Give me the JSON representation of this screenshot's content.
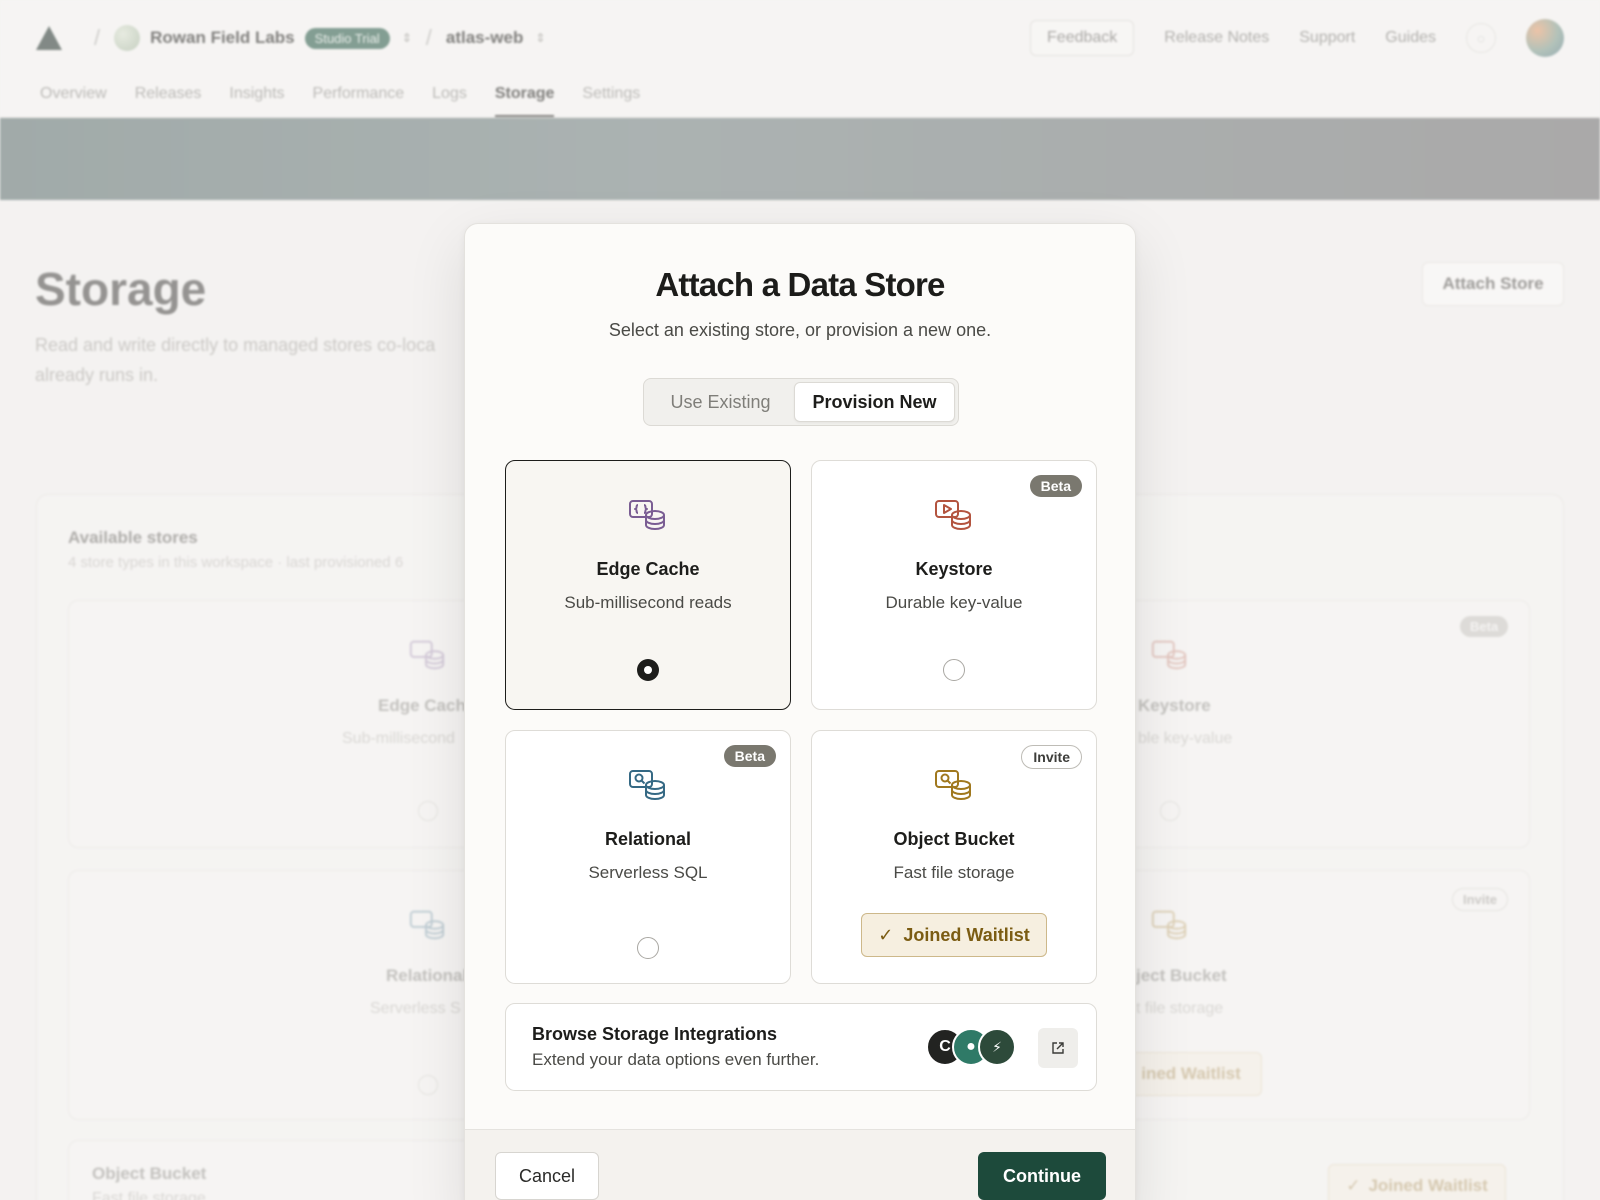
{
  "header": {
    "org_name": "Rowan Field Labs",
    "plan_badge": "Studio Trial",
    "project_name": "atlas-web",
    "feedback_label": "Feedback",
    "links": [
      "Release Notes",
      "Support",
      "Guides"
    ]
  },
  "nav": {
    "tabs": [
      "Overview",
      "Releases",
      "Insights",
      "Performance",
      "Logs",
      "Storage",
      "Settings"
    ],
    "active_tab": "Storage"
  },
  "page": {
    "title": "Storage",
    "description": "Read and write directly to managed stores co-loca already runs in.",
    "attach_store_label": "Attach Store",
    "panel_title": "Available stores",
    "panel_subtitle": "4 store types in this workspace · last provisioned 6",
    "cards": [
      {
        "title": "Edge Cache",
        "desc": "Sub-millisecond"
      },
      {
        "title": "Keystore",
        "desc": "ble key-value",
        "badge": "Beta"
      },
      {
        "title": "Relational",
        "desc": "Serverless S"
      },
      {
        "title": "ject Bucket",
        "desc": "t file storage",
        "badge": "Invite",
        "action": "ined Waitlist"
      },
      {
        "title": "Object Bucket",
        "desc": "Fast file storage"
      }
    ],
    "bottom_waitlist_label": "Joined Waitlist"
  },
  "modal": {
    "title": "Attach a Data Store",
    "subtitle": "Select an existing store, or provision a new one.",
    "segments": [
      "Use Existing",
      "Provision New"
    ],
    "selected_segment": "Provision New",
    "stores": [
      {
        "title": "Edge Cache",
        "desc": "Sub-millisecond reads",
        "selected": true,
        "icon": "edge-cache-icon",
        "color": "#7a5d93"
      },
      {
        "title": "Keystore",
        "desc": "Durable key-value",
        "badge": "Beta",
        "selected": false,
        "icon": "keystore-icon",
        "color": "#b3543f"
      },
      {
        "title": "Relational",
        "desc": "Serverless SQL",
        "badge": "Beta",
        "selected": false,
        "icon": "relational-icon",
        "color": "#356984"
      },
      {
        "title": "Object Bucket",
        "desc": "Fast file storage",
        "badge": "Invite",
        "action": "Joined Waitlist",
        "icon": "object-bucket-icon",
        "color": "#a0781e"
      }
    ],
    "integrations": {
      "title": "Browse Storage Integrations",
      "desc": "Extend your data options even further.",
      "avatars": [
        "C",
        "●",
        "⚡"
      ]
    },
    "cancel_label": "Cancel",
    "continue_label": "Continue"
  },
  "colors": {
    "primary": "#1d4a3b",
    "beta_badge": "#7a786f",
    "waitlist_text": "#7b5c13",
    "trial_badge": "#3e6b59"
  }
}
